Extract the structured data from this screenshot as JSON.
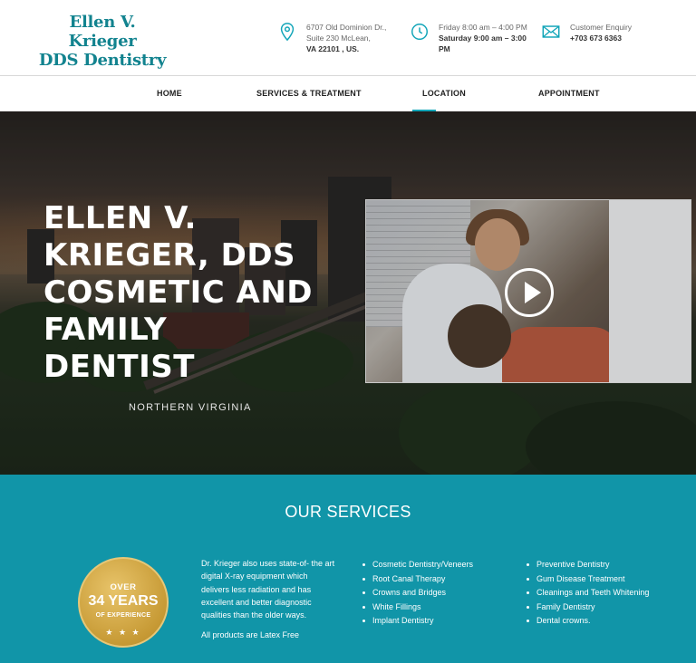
{
  "header": {
    "logo_line1": "Ellen V. Krieger",
    "logo_line2": "DDS Dentistry",
    "address": {
      "line1": "6707 Old Dominion Dr.,",
      "line2": "Suite 230 McLean,",
      "line3": "VA 22101 , US."
    },
    "hours": {
      "line1": "Friday 8:00 am – 4:00 PM",
      "line2": "Saturday 9:00 am – 3:00",
      "line3": "PM"
    },
    "contact": {
      "label": "Customer Enquiry",
      "phone": "+703 673 6363"
    }
  },
  "nav": {
    "items": [
      "HOME",
      "SERVICES & TREATMENT",
      "LOCATION",
      "APPOINTMENT"
    ],
    "active": "LOCATION"
  },
  "hero": {
    "title_lines": [
      "ELLEN V.",
      "KRIEGER, DDS",
      "COSMETIC AND",
      "FAMILY",
      "DENTIST"
    ],
    "subtitle": "NORTHERN VIRGINIA",
    "video_icon": "play-icon"
  },
  "services": {
    "title": "OUR SERVICES",
    "badge": {
      "line1": "OVER",
      "line2": "34 YEARS",
      "line3": "OF EXPERIENCE",
      "stars": "★ ★ ★"
    },
    "description": "Dr. Krieger also uses state-of- the art digital X-ray equipment which delivers less radiation and has excellent and better diagnostic qualities than the older ways.",
    "latex_note": "All products are Latex Free",
    "list1": [
      "Cosmetic Dentistry/Veneers",
      "Root Canal Therapy",
      "Crowns and Bridges",
      "White Fillings",
      "Implant Dentistry"
    ],
    "list2": [
      "Preventive Dentistry",
      "Gum Disease Treatment",
      "Cleanings and Teeth Whitening",
      "Family Dentistry",
      "Dental crowns."
    ]
  },
  "colors": {
    "brand": "#12838f",
    "accent": "#1195a8",
    "badge_gold": "#c79a35"
  }
}
